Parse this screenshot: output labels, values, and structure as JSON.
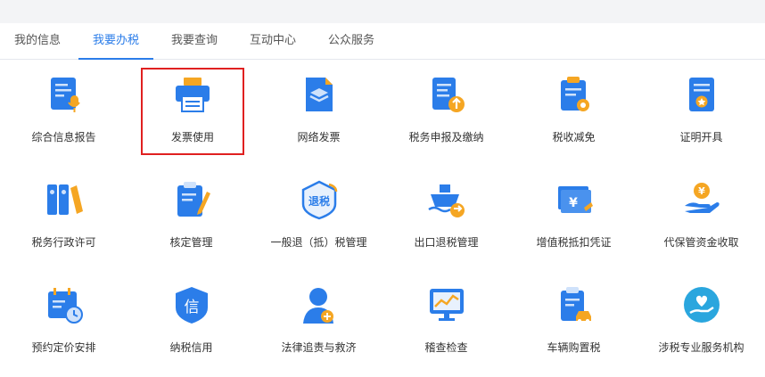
{
  "tabs": [
    {
      "label": "我的信息"
    },
    {
      "label": "我要办税"
    },
    {
      "label": "我要查询"
    },
    {
      "label": "互动中心"
    },
    {
      "label": "公众服务"
    }
  ],
  "active_tab": 1,
  "selected_tile": 1,
  "colors": {
    "accent": "#2b7de9",
    "highlight": "#e02020",
    "orange": "#f5a623"
  },
  "tiles": [
    {
      "label": "综合信息报告",
      "icon": "report-mic-icon"
    },
    {
      "label": "发票使用",
      "icon": "printer-icon"
    },
    {
      "label": "网络发票",
      "icon": "layers-document-icon"
    },
    {
      "label": "税务申报及缴纳",
      "icon": "declare-upload-icon"
    },
    {
      "label": "税收减免",
      "icon": "clipboard-discount-icon"
    },
    {
      "label": "证明开具",
      "icon": "certificate-icon"
    },
    {
      "label": "税务行政许可",
      "icon": "binders-icon"
    },
    {
      "label": "核定管理",
      "icon": "clipboard-pen-icon"
    },
    {
      "label": "一般退（抵）税管理",
      "icon": "refund-shield-icon",
      "badge": "退税"
    },
    {
      "label": "出口退税管理",
      "icon": "ship-export-icon"
    },
    {
      "label": "增值税抵扣凭证",
      "icon": "tickets-yen-icon",
      "badge": "¥"
    },
    {
      "label": "代保管资金收取",
      "icon": "hand-coin-icon",
      "badge": "¥"
    },
    {
      "label": "预约定价安排",
      "icon": "calendar-clock-icon"
    },
    {
      "label": "纳税信用",
      "icon": "credit-shield-icon",
      "badge": "信"
    },
    {
      "label": "法律追责与救济",
      "icon": "lawyer-scale-icon"
    },
    {
      "label": "稽查检查",
      "icon": "monitor-chart-icon"
    },
    {
      "label": "车辆购置税",
      "icon": "clipboard-car-icon"
    },
    {
      "label": "涉税专业服务机构",
      "icon": "heart-hand-icon"
    }
  ]
}
